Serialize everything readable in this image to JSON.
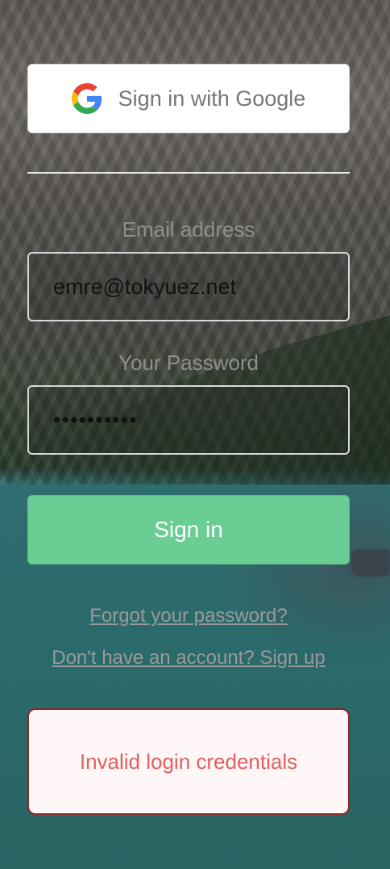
{
  "auth": {
    "google_button_label": "Sign in with Google",
    "email_label": "Email address",
    "email_value": "emre@tokyuez.net",
    "password_label": "Your Password",
    "password_value": "••••••••••",
    "signin_button_label": "Sign in",
    "forgot_password_link": "Forgot your password?",
    "signup_link": "Don't have an account? Sign up",
    "error_message": "Invalid login credentials"
  },
  "colors": {
    "signin_button": "#6acd94",
    "error_text": "#e0605e",
    "error_border": "#8a2a2a",
    "label_text": "#8e8e8e"
  },
  "icons": {
    "google": "google-g-icon"
  }
}
